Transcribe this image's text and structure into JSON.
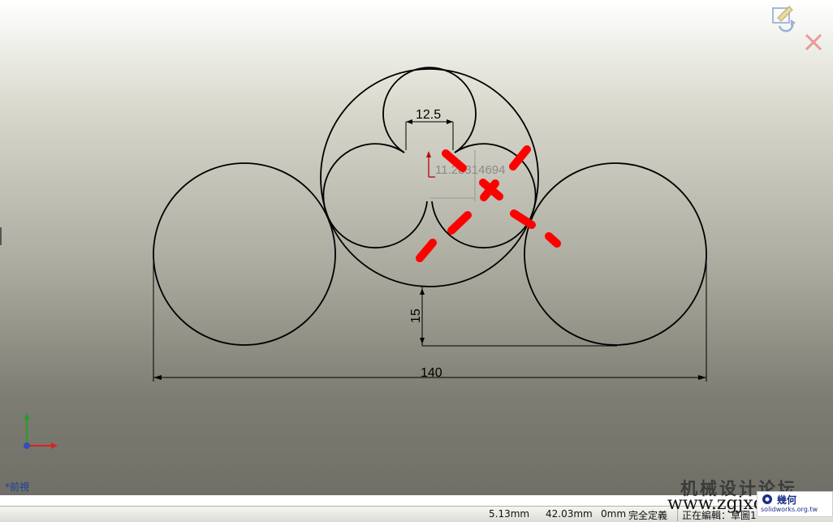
{
  "sketch": {
    "dimensions": {
      "top_width": "12.5",
      "ghost_value": "11.28314694",
      "vertical_offset": "15",
      "overall_width": "140"
    }
  },
  "view": {
    "label": "*前視"
  },
  "watermark": {
    "cn_text": "机械设计论坛",
    "url": "www.zgjxcad.com",
    "logo_cn": "幾何",
    "logo_sub": "solidworks.org.tw"
  },
  "statusbar": {
    "x_coord": "5.13mm",
    "y_coord": "42.03mm",
    "z_coord": "0mm",
    "constraint_state": "完全定義",
    "editing": "正在編輯：草圖1"
  },
  "icons": {
    "confirm": "confirm-sketch-icon",
    "close": "close-sketch-icon",
    "triad": "coordinate-triad-icon"
  },
  "colors": {
    "sketch_line": "#000000",
    "markup_red": "#ff0000",
    "axis_red": "#e02020",
    "axis_green": "#2a9a2a",
    "view_label": "#1f3f9a"
  }
}
